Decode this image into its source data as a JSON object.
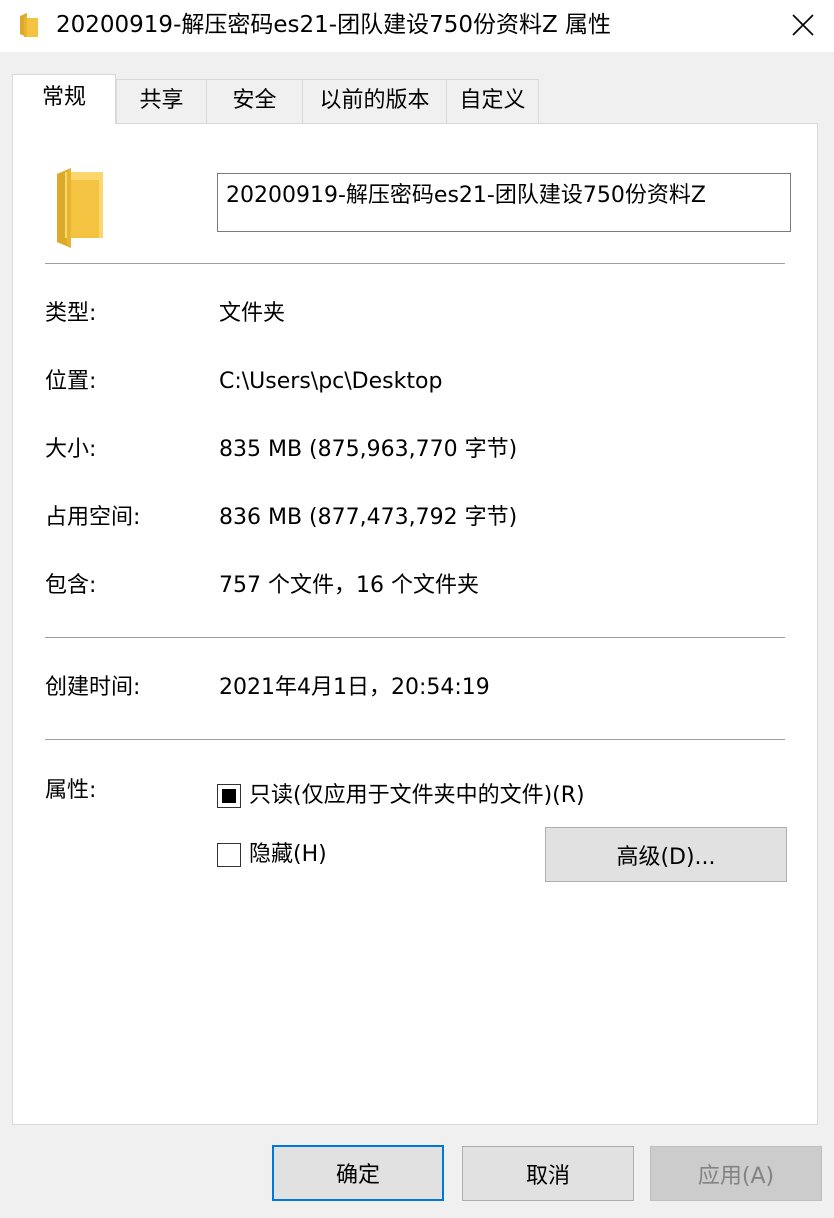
{
  "window": {
    "title": "20200919-解压密码es21-团队建设750份资料Z 属性",
    "close_icon": "close-icon",
    "folder_icon_color": "#f5c342"
  },
  "tabs": [
    {
      "label": "常规",
      "active": true
    },
    {
      "label": "共享",
      "active": false
    },
    {
      "label": "安全",
      "active": false
    },
    {
      "label": "以前的版本",
      "active": false
    },
    {
      "label": "自定义",
      "active": false
    }
  ],
  "general": {
    "folder_name": "20200919-解压密码es21-团队建设750份资料Z",
    "type_label": "类型:",
    "type_value": "文件夹",
    "location_label": "位置:",
    "location_value": "C:\\Users\\pc\\Desktop",
    "size_label": "大小:",
    "size_value": "835 MB (875,963,770 字节)",
    "size_on_disk_label": "占用空间:",
    "size_on_disk_value": "836 MB (877,473,792 字节)",
    "contains_label": "包含:",
    "contains_value": "757 个文件，16 个文件夹",
    "created_label": "创建时间:",
    "created_value": "2021年4月1日，20:54:19",
    "attributes_label": "属性:",
    "readonly_label": "只读(仅应用于文件夹中的文件)(R)",
    "readonly_state": "indeterminate",
    "hidden_label": "隐藏(H)",
    "hidden_state": "unchecked",
    "advanced_label": "高级(D)..."
  },
  "footer": {
    "ok_label": "确定",
    "cancel_label": "取消",
    "apply_label": "应用(A)"
  },
  "colors": {
    "accent": "#0078d7",
    "folder": "#f5c342"
  }
}
